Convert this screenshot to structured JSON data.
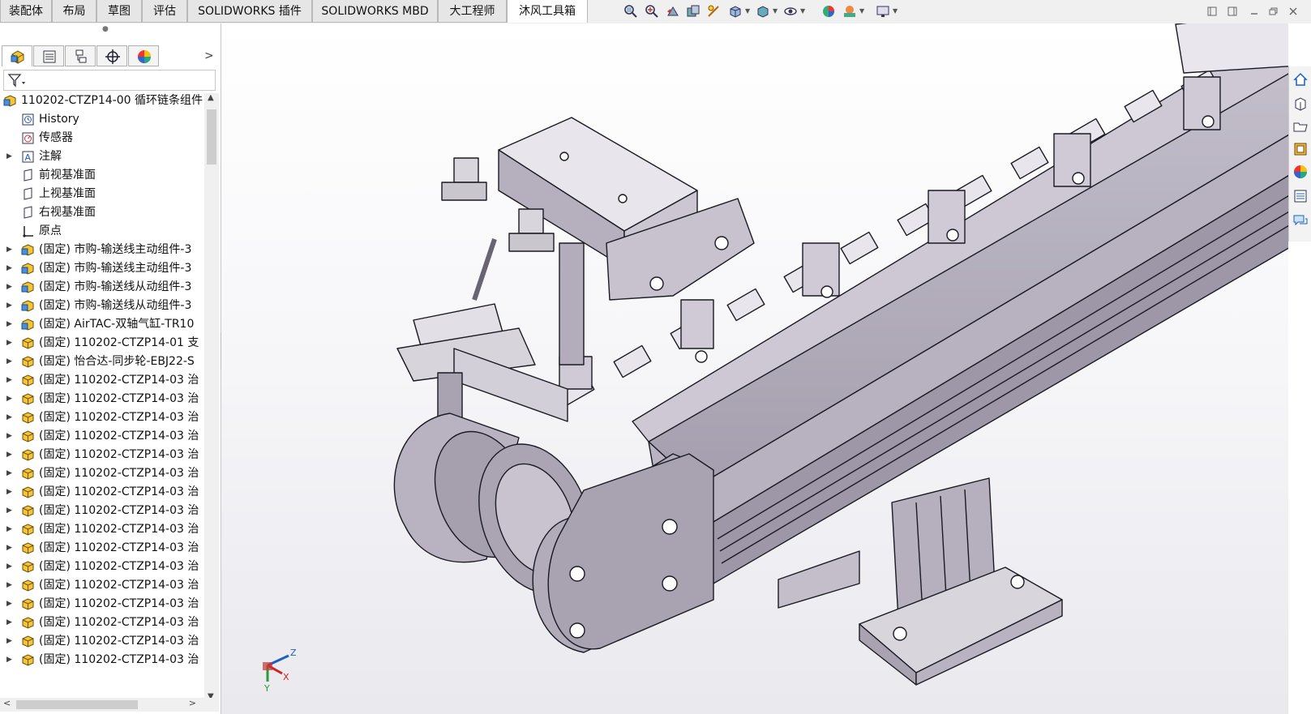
{
  "tabs": [
    {
      "label": "装配体",
      "active": false
    },
    {
      "label": "布局",
      "active": false
    },
    {
      "label": "草图",
      "active": false
    },
    {
      "label": "评估",
      "active": false
    },
    {
      "label": "SOLIDWORKS 插件",
      "active": false
    },
    {
      "label": "SOLIDWORKS MBD",
      "active": false
    },
    {
      "label": "大工程师",
      "active": false
    },
    {
      "label": "沐风工具箱",
      "active": true
    }
  ],
  "view_toolbar": [
    "zoom-to-fit-icon",
    "zoom-area-icon",
    "previous-view-icon",
    "section-view-icon",
    "view-orientation-icon",
    "display-style-icon",
    "hide-show-icon",
    "appearance-icon",
    "scene-icon",
    "view-settings-icon"
  ],
  "panel_tabs": [
    "feature-manager-icon",
    "property-manager-icon",
    "configuration-manager-icon",
    "dimxpert-icon",
    "display-manager-icon"
  ],
  "tree": {
    "root": "110202-CTZP14-00 循环链条组件",
    "items": [
      {
        "label": "History",
        "icon": "history-icon",
        "expand": false
      },
      {
        "label": "传感器",
        "icon": "sensor-icon",
        "expand": false
      },
      {
        "label": "注解",
        "icon": "annotation-icon",
        "expand": true
      },
      {
        "label": "前视基准面",
        "icon": "plane-icon",
        "expand": false
      },
      {
        "label": "上视基准面",
        "icon": "plane-icon",
        "expand": false
      },
      {
        "label": "右视基准面",
        "icon": "plane-icon",
        "expand": false
      },
      {
        "label": "原点",
        "icon": "origin-icon",
        "expand": false
      },
      {
        "label": "(固定) 市购-输送线主动组件-3",
        "icon": "subassembly-icon",
        "expand": true
      },
      {
        "label": "(固定) 市购-输送线主动组件-3",
        "icon": "subassembly-icon",
        "expand": true
      },
      {
        "label": "(固定) 市购-输送线从动组件-3",
        "icon": "subassembly-icon",
        "expand": true
      },
      {
        "label": "(固定) 市购-输送线从动组件-3",
        "icon": "subassembly-icon",
        "expand": true
      },
      {
        "label": "(固定) AirTAC-双轴气缸-TR10",
        "icon": "subassembly-icon",
        "expand": true
      },
      {
        "label": "(固定) 110202-CTZP14-01 支",
        "icon": "part-icon",
        "expand": true
      },
      {
        "label": "(固定) 怡合达-同步轮-EBJ22-S",
        "icon": "part-icon",
        "expand": true
      },
      {
        "label": "(固定) 110202-CTZP14-03 治",
        "icon": "part-icon",
        "expand": true
      },
      {
        "label": "(固定) 110202-CTZP14-03 治",
        "icon": "part-icon",
        "expand": true
      },
      {
        "label": "(固定) 110202-CTZP14-03 治",
        "icon": "part-icon",
        "expand": true
      },
      {
        "label": "(固定) 110202-CTZP14-03 治",
        "icon": "part-icon",
        "expand": true
      },
      {
        "label": "(固定) 110202-CTZP14-03 治",
        "icon": "part-icon",
        "expand": true
      },
      {
        "label": "(固定) 110202-CTZP14-03 治",
        "icon": "part-icon",
        "expand": true
      },
      {
        "label": "(固定) 110202-CTZP14-03 治",
        "icon": "part-icon",
        "expand": true
      },
      {
        "label": "(固定) 110202-CTZP14-03 治",
        "icon": "part-icon",
        "expand": true
      },
      {
        "label": "(固定) 110202-CTZP14-03 治",
        "icon": "part-icon",
        "expand": true
      },
      {
        "label": "(固定) 110202-CTZP14-03 治",
        "icon": "part-icon",
        "expand": true
      },
      {
        "label": "(固定) 110202-CTZP14-03 治",
        "icon": "part-icon",
        "expand": true
      },
      {
        "label": "(固定) 110202-CTZP14-03 治",
        "icon": "part-icon",
        "expand": true
      },
      {
        "label": "(固定) 110202-CTZP14-03 治",
        "icon": "part-icon",
        "expand": true
      },
      {
        "label": "(固定) 110202-CTZP14-03 治",
        "icon": "part-icon",
        "expand": true
      },
      {
        "label": "(固定) 110202-CTZP14-03 治",
        "icon": "part-icon",
        "expand": true
      },
      {
        "label": "(固定) 110202-CTZP14-03 治",
        "icon": "part-icon",
        "expand": true
      }
    ]
  },
  "triad": {
    "x": "X",
    "y": "Y",
    "z": "Z"
  },
  "taskpane": [
    "home-icon",
    "design-library-icon",
    "file-explorer-icon",
    "view-palette-icon",
    "appearances-icon",
    "custom-properties-icon",
    "forum-icon"
  ],
  "colors": {
    "model": "#a8a2b0",
    "model_dark": "#8a8494",
    "accent": "#1f5fbf"
  }
}
